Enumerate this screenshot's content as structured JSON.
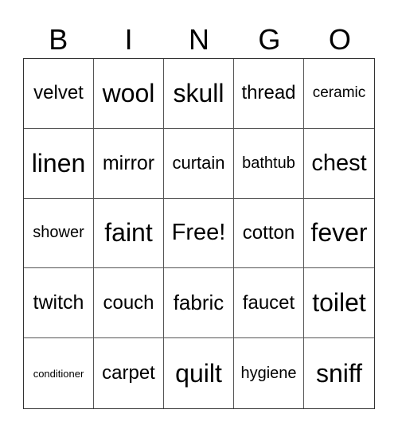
{
  "header": [
    "B",
    "I",
    "N",
    "G",
    "O"
  ],
  "cells": [
    {
      "text": "velvet",
      "size": 24
    },
    {
      "text": "wool",
      "size": 32
    },
    {
      "text": "skull",
      "size": 32
    },
    {
      "text": "thread",
      "size": 24
    },
    {
      "text": "ceramic",
      "size": 19
    },
    {
      "text": "linen",
      "size": 32
    },
    {
      "text": "mirror",
      "size": 25
    },
    {
      "text": "curtain",
      "size": 22
    },
    {
      "text": "bathtub",
      "size": 20
    },
    {
      "text": "chest",
      "size": 29
    },
    {
      "text": "shower",
      "size": 20
    },
    {
      "text": "faint",
      "size": 32
    },
    {
      "text": "Free!",
      "size": 29
    },
    {
      "text": "cotton",
      "size": 24
    },
    {
      "text": "fever",
      "size": 32
    },
    {
      "text": "twitch",
      "size": 25
    },
    {
      "text": "couch",
      "size": 24
    },
    {
      "text": "fabric",
      "size": 26
    },
    {
      "text": "faucet",
      "size": 24
    },
    {
      "text": "toilet",
      "size": 32
    },
    {
      "text": "conditioner",
      "size": 13
    },
    {
      "text": "carpet",
      "size": 24
    },
    {
      "text": "quilt",
      "size": 32
    },
    {
      "text": "hygiene",
      "size": 20
    },
    {
      "text": "sniff",
      "size": 32
    }
  ]
}
